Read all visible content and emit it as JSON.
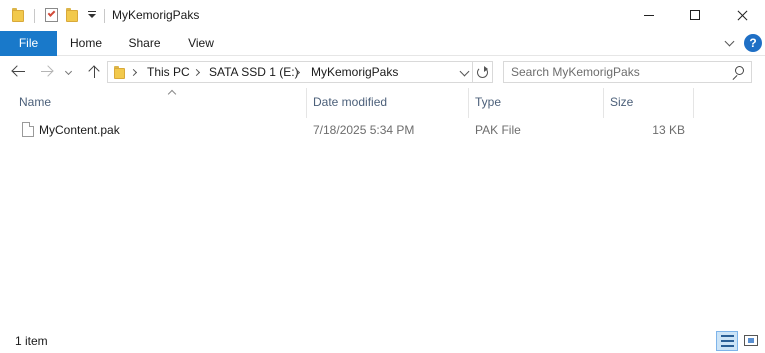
{
  "window": {
    "title": "MyKemorigPaks"
  },
  "ribbon": {
    "tabs": [
      {
        "label": "File",
        "active": true
      },
      {
        "label": "Home"
      },
      {
        "label": "Share"
      },
      {
        "label": "View"
      }
    ],
    "help_label": "?"
  },
  "navigation": {
    "breadcrumb": [
      "This PC",
      "SATA SSD 1 (E:)",
      "MyKemorigPaks"
    ],
    "search_placeholder": "Search MyKemorigPaks"
  },
  "columns": {
    "name": "Name",
    "date_modified": "Date modified",
    "type": "Type",
    "size": "Size"
  },
  "files": [
    {
      "name": "MyContent.pak",
      "date_modified": "7/18/2025 5:34 PM",
      "type": "PAK File",
      "size": "13 KB"
    }
  ],
  "status": {
    "item_count": "1 item"
  },
  "colors": {
    "file_tab_bg": "#1979ca",
    "help_icon": "#1f6fc5",
    "header_text": "#4c607a",
    "selected_view_bg": "#cce4f7"
  },
  "icons": [
    "folder-icon",
    "properties-icon",
    "new-folder-icon",
    "customize-qat-icon",
    "minimize-icon",
    "maximize-icon",
    "close-icon",
    "help-icon",
    "back-arrow-icon",
    "forward-arrow-icon",
    "recent-locations-icon",
    "up-arrow-icon",
    "refresh-icon",
    "search-icon",
    "file-icon",
    "details-view-icon",
    "large-icons-view-icon"
  ]
}
